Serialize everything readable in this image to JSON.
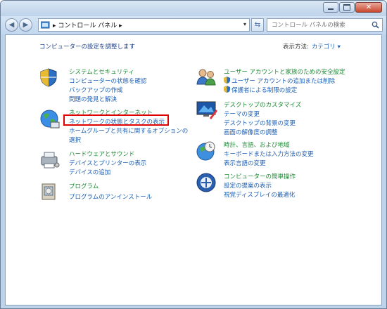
{
  "address": {
    "breadcrumb": "コントロール パネル",
    "search_placeholder": "コントロール パネルの検索"
  },
  "page": {
    "title": "コンピューターの設定を調整します",
    "view_by_label": "表示方法:",
    "view_by_value": "カテゴリ"
  },
  "categories": {
    "system": {
      "title": "システムとセキュリティ",
      "links": [
        "コンピューターの状態を確認",
        "バックアップの作成",
        "問題の発見と解決"
      ]
    },
    "network": {
      "title": "ネットワークとインターネット",
      "links": [
        "ネットワークの状態とタスクの表示",
        "ホームグループと共有に関するオプションの",
        "選択"
      ]
    },
    "hardware": {
      "title": "ハードウェアとサウンド",
      "links": [
        "デバイスとプリンターの表示",
        "デバイスの追加"
      ]
    },
    "programs": {
      "title": "プログラム",
      "links": [
        "プログラムのアンインストール"
      ]
    },
    "user": {
      "title": "ユーザー アカウントと家族のための安全設定",
      "links": [
        "ユーザー アカウントの追加または削除",
        "保護者による制限の設定"
      ]
    },
    "appearance": {
      "title": "デスクトップのカスタマイズ",
      "links": [
        "テーマの変更",
        "デスクトップの背景の変更",
        "画面の解像度の調整"
      ]
    },
    "clock": {
      "title": "時計、言語、および地域",
      "links": [
        "キーボードまたは入力方法の変更",
        "表示言語の変更"
      ]
    },
    "ease": {
      "title": "コンピューターの簡単操作",
      "links": [
        "設定の提案の表示",
        "視覚ディスプレイの最適化"
      ]
    }
  },
  "icons": {
    "minimize": "minimize-icon",
    "maximize": "maximize-icon",
    "close": "close-icon",
    "back": "back-arrow-icon",
    "forward": "forward-arrow-icon",
    "refresh": "refresh-icon",
    "search": "search-icon",
    "shield": "shield-icon"
  },
  "colors": {
    "title_green": "#1d8a33",
    "link_blue": "#1b5fb6",
    "highlight_red": "#e00000"
  }
}
